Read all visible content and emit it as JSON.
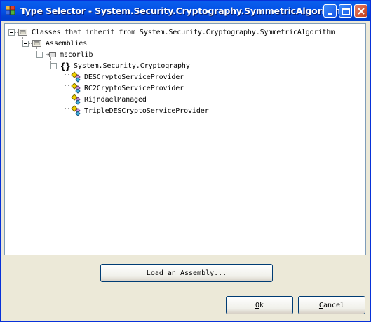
{
  "window": {
    "title": "Type Selector - System.Security.Cryptography.SymmetricAlgorithm"
  },
  "title_buttons": {
    "minimize_icon": "minimize-icon",
    "maximize_icon": "maximize-icon",
    "close_icon": "close-icon"
  },
  "tree": {
    "root": "Classes that inherit from System.Security.Cryptography.SymmetricAlgorithm",
    "assemblies": "Assemblies",
    "assembly": "mscorlib",
    "namespace": "System.Security.Cryptography",
    "classes": [
      "DESCryptoServiceProvider",
      "RC2CryptoServiceProvider",
      "RijndaelManaged",
      "TripleDESCryptoServiceProvider"
    ]
  },
  "buttons": {
    "load_first": "L",
    "load_rest": "oad an Assembly...",
    "ok_first": "O",
    "ok_rest": "k",
    "cancel_first": "C",
    "cancel_rest": "ancel"
  }
}
